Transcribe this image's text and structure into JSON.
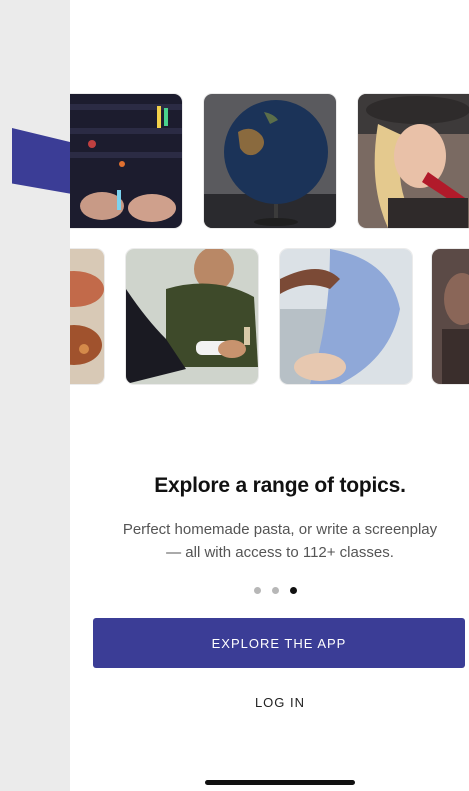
{
  "onboarding": {
    "title": "Explore a range of topics.",
    "subtitle_line1": "Perfect homemade pasta, or write a screenplay",
    "subtitle_line2": "— all with access to 112+ classes.",
    "pagination": {
      "total": 3,
      "active": 3
    },
    "primary_button": "EXPLORE THE APP",
    "secondary_link": "LOG IN"
  },
  "gallery": {
    "row1": [
      "mixing-console-photo",
      "globe-photo",
      "singer-microphone-photo"
    ],
    "row2": [
      "food-photo",
      "chess-players-photo",
      "dancer-photo",
      "partial-photo"
    ]
  },
  "colors": {
    "accent": "#3b3d96",
    "text": "#111111",
    "muted": "#555555"
  }
}
